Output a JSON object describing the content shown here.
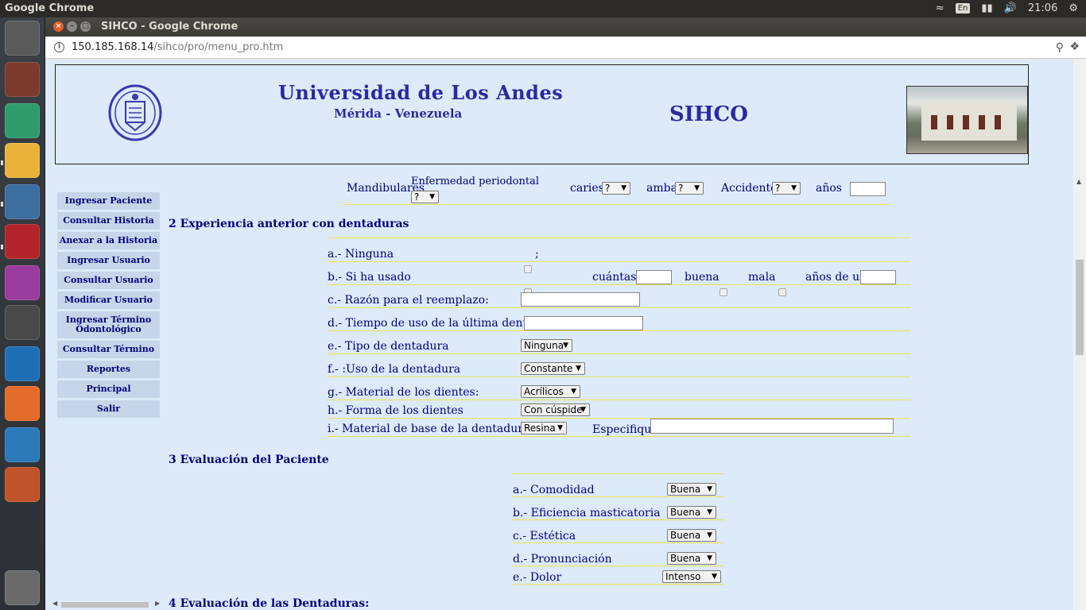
{
  "top_panel": {
    "app_title": "Google Chrome",
    "keyboard_layout": "En",
    "clock": "21:06"
  },
  "launcher": [
    {
      "name": "ubuntu-dash-icon",
      "color": "#5a5a5a"
    },
    {
      "name": "files-icon",
      "color": "#7b3a2e"
    },
    {
      "name": "atom-icon",
      "color": "#2f9a6b"
    },
    {
      "name": "chrome-icon",
      "color": "#e9b33b"
    },
    {
      "name": "postgres-elephant-icon",
      "color": "#3c6e9e"
    },
    {
      "name": "terminal-red-icon",
      "color": "#b3252a"
    },
    {
      "name": "purple-app-icon",
      "color": "#9a3b9e"
    },
    {
      "name": "sublime-text-icon",
      "color": "#4a4a4a"
    },
    {
      "name": "vscode-icon",
      "color": "#1f6fb5"
    },
    {
      "name": "postman-icon",
      "color": "#e46b2a"
    },
    {
      "name": "writer-doc-icon",
      "color": "#2a79b8"
    },
    {
      "name": "impress-presentation-icon",
      "color": "#c0532a"
    },
    {
      "name": "trash-icon",
      "color": "#6a6a6a"
    }
  ],
  "browser": {
    "window_title": "SIHCO - Google Chrome",
    "url_host": "150.185.168.14",
    "url_path": "/sihco/pro/menu_pro.htm"
  },
  "banner": {
    "university": "Universidad de Los Andes",
    "location": "Mérida - Venezuela",
    "system_name": "SIHCO"
  },
  "menu": [
    "Ingresar Paciente",
    "Consultar Historia",
    "Anexar a la Historia",
    "Ingresar Usuario",
    "Consultar Usuario",
    "Modificar Usuario",
    "Ingresar Término Odontológico",
    "Consultar Término",
    "Reportes",
    "Principal",
    "Salir"
  ],
  "top_row": {
    "mandibulares": "Mandibulares",
    "enfermedad": "Enfermedad periodontal",
    "enfermedad_value": "?",
    "caries": "caries",
    "caries_value": "?",
    "ambas": "ambas",
    "ambas_value": "?",
    "accidente": "Accidente",
    "accidente_value": "?",
    "anos": "años"
  },
  "section2": {
    "title": "2 Experiencia anterior con dentaduras",
    "a_label": "a.- Ninguna",
    "a_suffix": ";",
    "b_label": "b.- Si ha usado",
    "b_cuantas": "cuántas?",
    "b_buena": "buena",
    "b_mala": "mala",
    "b_anos_uso": "años de uso",
    "c_label": "c.- Razón para el reemplazo:",
    "d_label": "d.- Tiempo de uso de la última dentadura",
    "e_label": "e.- Tipo de dentadura",
    "e_value": "Ninguna",
    "f_label": "f.- :Uso de la dentadura",
    "f_value": "Constante",
    "g_label": "g.- Material de los dientes:",
    "g_value": "Acrílicos",
    "h_label": "h.- Forma de los dientes",
    "h_value": "Con cúspide",
    "i_label": "i.- Material de base de la dentadura:",
    "i_value": "Resina",
    "i_especifique": "Especifique:"
  },
  "section3": {
    "title": "3 Evaluación del Paciente",
    "a_label": "a.- Comodidad",
    "a_value": "Buena",
    "b_label": "b.- Eficiencia masticatoria",
    "b_value": "Buena",
    "c_label": "c.- Estética",
    "c_value": "Buena",
    "d_label": "d.- Pronunciación",
    "d_value": "Buena",
    "e_label": "e.- Dolor",
    "e_value": "Intenso"
  },
  "section4": {
    "title": "4 Evaluación de las Dentaduras:"
  }
}
